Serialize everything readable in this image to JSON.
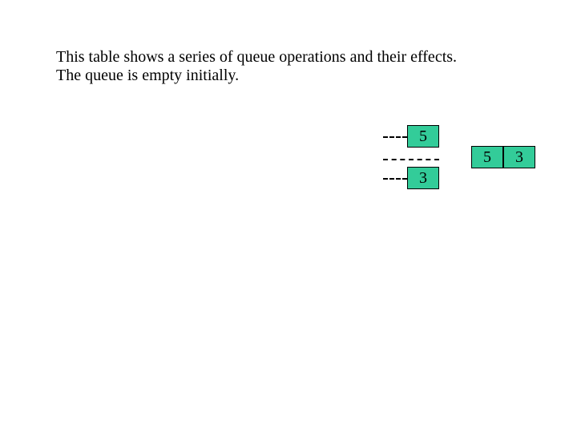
{
  "caption": {
    "line1": "This table shows a series of queue operations and their effects.",
    "line2": "The queue is empty initially."
  },
  "colors": {
    "cell_fill": "#33cc99",
    "cell_border": "#000000"
  },
  "cells": {
    "top": "5",
    "bottom": "3",
    "right_a": "5",
    "right_b": "3"
  }
}
